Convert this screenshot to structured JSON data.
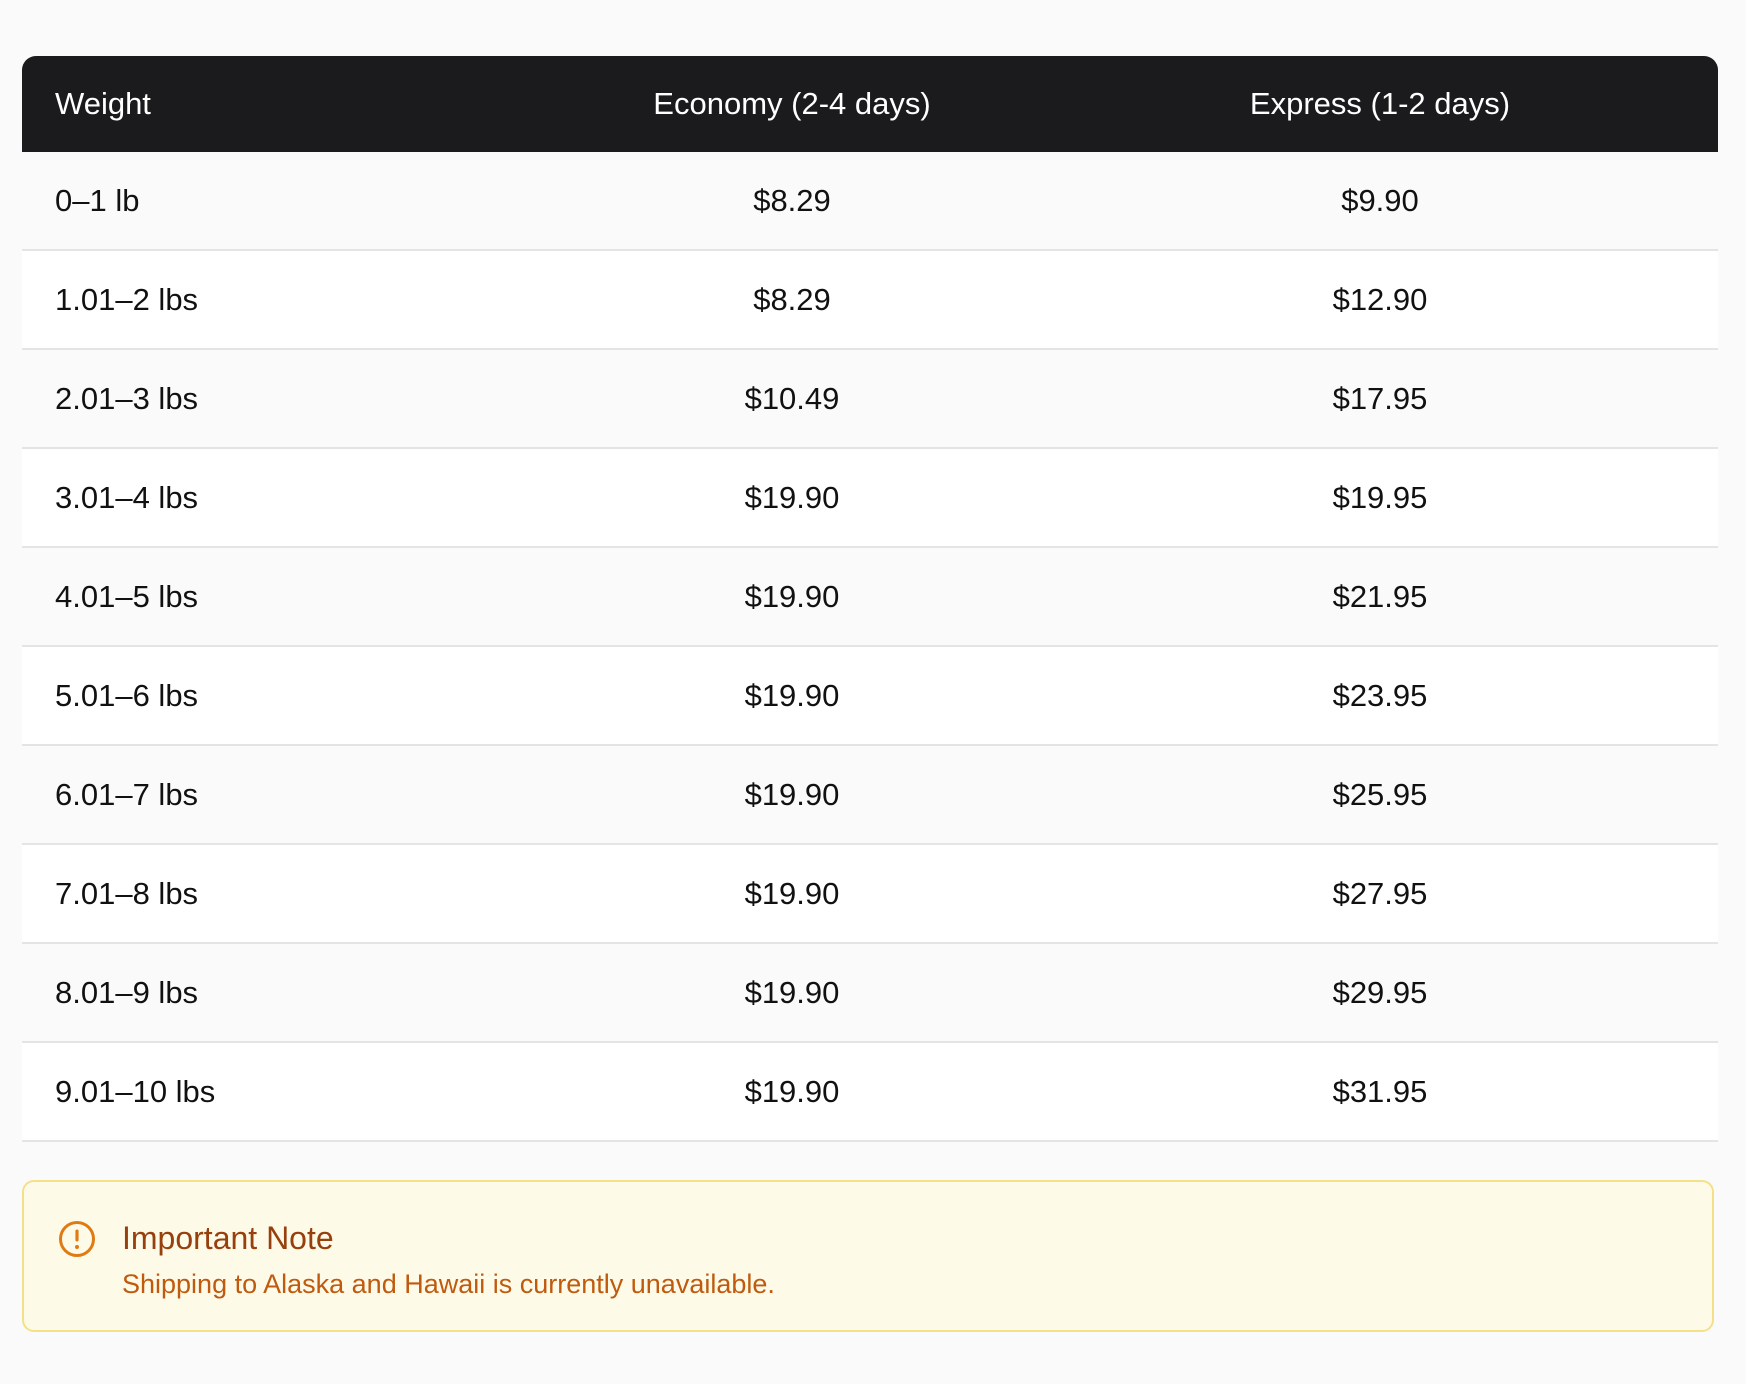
{
  "table": {
    "headers": [
      "Weight",
      "Economy (2-4 days)",
      "Express (1-2 days)"
    ],
    "rows": [
      {
        "weight": "0–1 lb",
        "economy": "$8.29",
        "express": "$9.90"
      },
      {
        "weight": "1.01–2 lbs",
        "economy": "$8.29",
        "express": "$12.90"
      },
      {
        "weight": "2.01–3 lbs",
        "economy": "$10.49",
        "express": "$17.95"
      },
      {
        "weight": "3.01–4 lbs",
        "economy": "$19.90",
        "express": "$19.95"
      },
      {
        "weight": "4.01–5 lbs",
        "economy": "$19.90",
        "express": "$21.95"
      },
      {
        "weight": "5.01–6 lbs",
        "economy": "$19.90",
        "express": "$23.95"
      },
      {
        "weight": "6.01–7 lbs",
        "economy": "$19.90",
        "express": "$25.95"
      },
      {
        "weight": "7.01–8 lbs",
        "economy": "$19.90",
        "express": "$27.95"
      },
      {
        "weight": "8.01–9 lbs",
        "economy": "$19.90",
        "express": "$29.95"
      },
      {
        "weight": "9.01–10 lbs",
        "economy": "$19.90",
        "express": "$31.95"
      }
    ]
  },
  "note": {
    "icon": "alert-circle-icon",
    "title": "Important Note",
    "text": "Shipping to Alaska and Hawaii is currently unavailable."
  },
  "colors": {
    "header_bg": "#1b1b1d",
    "note_bg": "#fefae8",
    "note_border": "#f5e08a",
    "note_title": "#97400d",
    "note_text": "#bf5a0e",
    "note_icon": "#e07b14"
  }
}
